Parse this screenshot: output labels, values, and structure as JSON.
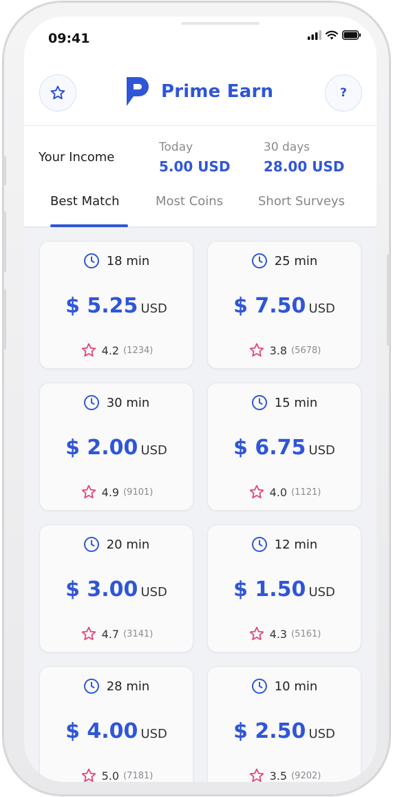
{
  "status_bar": {
    "time": "09:41"
  },
  "header": {
    "brand_name": "Prime Earn",
    "help_label": "?",
    "favorites_icon": "star-outline-icon",
    "brand_color": "#2f56d6"
  },
  "income": {
    "label": "Your Income",
    "today_caption": "Today",
    "today_value": "5.00 USD",
    "month_caption": "30 days",
    "month_value": "28.00 USD"
  },
  "tabs": [
    {
      "label": "Best Match",
      "active": true
    },
    {
      "label": "Most Coins",
      "active": false
    },
    {
      "label": "Short Surveys",
      "active": false
    }
  ],
  "surveys": [
    {
      "duration": "18 min",
      "amount": "$ 5.25",
      "currency": "USD",
      "rating": "4.2",
      "reviews": "(1234)"
    },
    {
      "duration": "25 min",
      "amount": "$ 7.50",
      "currency": "USD",
      "rating": "3.8",
      "reviews": "(5678)"
    },
    {
      "duration": "30 min",
      "amount": "$ 2.00",
      "currency": "USD",
      "rating": "4.9",
      "reviews": "(9101)"
    },
    {
      "duration": "15 min",
      "amount": "$ 6.75",
      "currency": "USD",
      "rating": "4.0",
      "reviews": "(1121)"
    },
    {
      "duration": "20 min",
      "amount": "$ 3.00",
      "currency": "USD",
      "rating": "4.7",
      "reviews": "(3141)"
    },
    {
      "duration": "12 min",
      "amount": "$ 1.50",
      "currency": "USD",
      "rating": "4.3",
      "reviews": "(5161)"
    },
    {
      "duration": "28 min",
      "amount": "$ 4.00",
      "currency": "USD",
      "rating": "5.0",
      "reviews": "(7181)"
    },
    {
      "duration": "10 min",
      "amount": "$ 2.50",
      "currency": "USD",
      "rating": "3.5",
      "reviews": "(9202)"
    }
  ],
  "colors": {
    "accent": "#2f56d6",
    "star": "#e0457a"
  }
}
